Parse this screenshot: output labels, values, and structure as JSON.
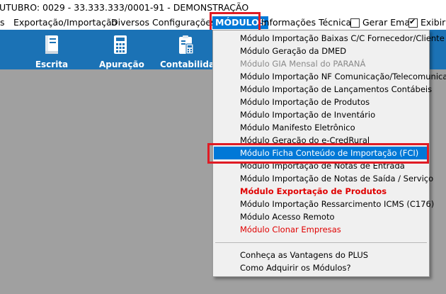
{
  "window": {
    "title": "UTUBRO: 0029 - 33.333.333/0001-91 - DEMONSTRAÇÃO"
  },
  "menubar": {
    "items": [
      "s",
      "Exportação/Importação",
      "Diversos",
      "Configurações",
      "MÓDULOS",
      "Informações Técnicas"
    ],
    "active": "MÓDULOS",
    "gerar_email": {
      "label": "Gerar Email",
      "checked": false
    },
    "exibir": {
      "label": "Exibir I",
      "checked": true
    }
  },
  "toolbar": {
    "buttons": [
      {
        "label": "Escrita",
        "icon": "book-icon"
      },
      {
        "label": "Apuração",
        "icon": "calculator-icon"
      },
      {
        "label": "Contabilidad",
        "icon": "clipboard-calc-icon"
      }
    ],
    "accent": "#1b72b5"
  },
  "modulos_menu": {
    "items": [
      {
        "label": "Módulo Importação Baixas C/C Fornecedor/Cliente",
        "state": "normal"
      },
      {
        "label": "Módulo Geração da DMED",
        "state": "normal"
      },
      {
        "label": "Módulo GIA Mensal do PARANÁ",
        "state": "disabled"
      },
      {
        "label": "Módulo Importação NF Comunicação/Telecomunicação",
        "state": "normal"
      },
      {
        "label": "Módulo Importação de Lançamentos Contábeis",
        "state": "normal"
      },
      {
        "label": "Módulo Importação de Produtos",
        "state": "normal"
      },
      {
        "label": "Módulo Importação de Inventário",
        "state": "normal"
      },
      {
        "label": "Módulo Manifesto Eletrônico",
        "state": "normal"
      },
      {
        "label": "Módulo Geração do e-CredRural",
        "state": "normal"
      },
      {
        "label": "Módulo Ficha Conteúdo de Importação (FCI)",
        "state": "selected"
      },
      {
        "label": "Módulo Importação de Notas de Entrada",
        "state": "normal"
      },
      {
        "label": "Módulo Importação de Notas de Saída / Serviço",
        "state": "normal"
      },
      {
        "label": "Módulo Exportação de Produtos",
        "state": "bold-red"
      },
      {
        "label": "Módulo Importação Ressarcimento ICMS (C176)",
        "state": "normal"
      },
      {
        "label": "Módulo Acesso Remoto",
        "state": "normal"
      },
      {
        "label": "Módulo Clonar Empresas",
        "state": "red"
      }
    ],
    "footer_items": [
      {
        "label": "Conheça as Vantagens do PLUS"
      },
      {
        "label": "Como Adquirir os Módulos?"
      }
    ]
  },
  "colors": {
    "selection": "#0078d7",
    "highlight_box": "#e01b24",
    "red_text": "#e00000"
  }
}
